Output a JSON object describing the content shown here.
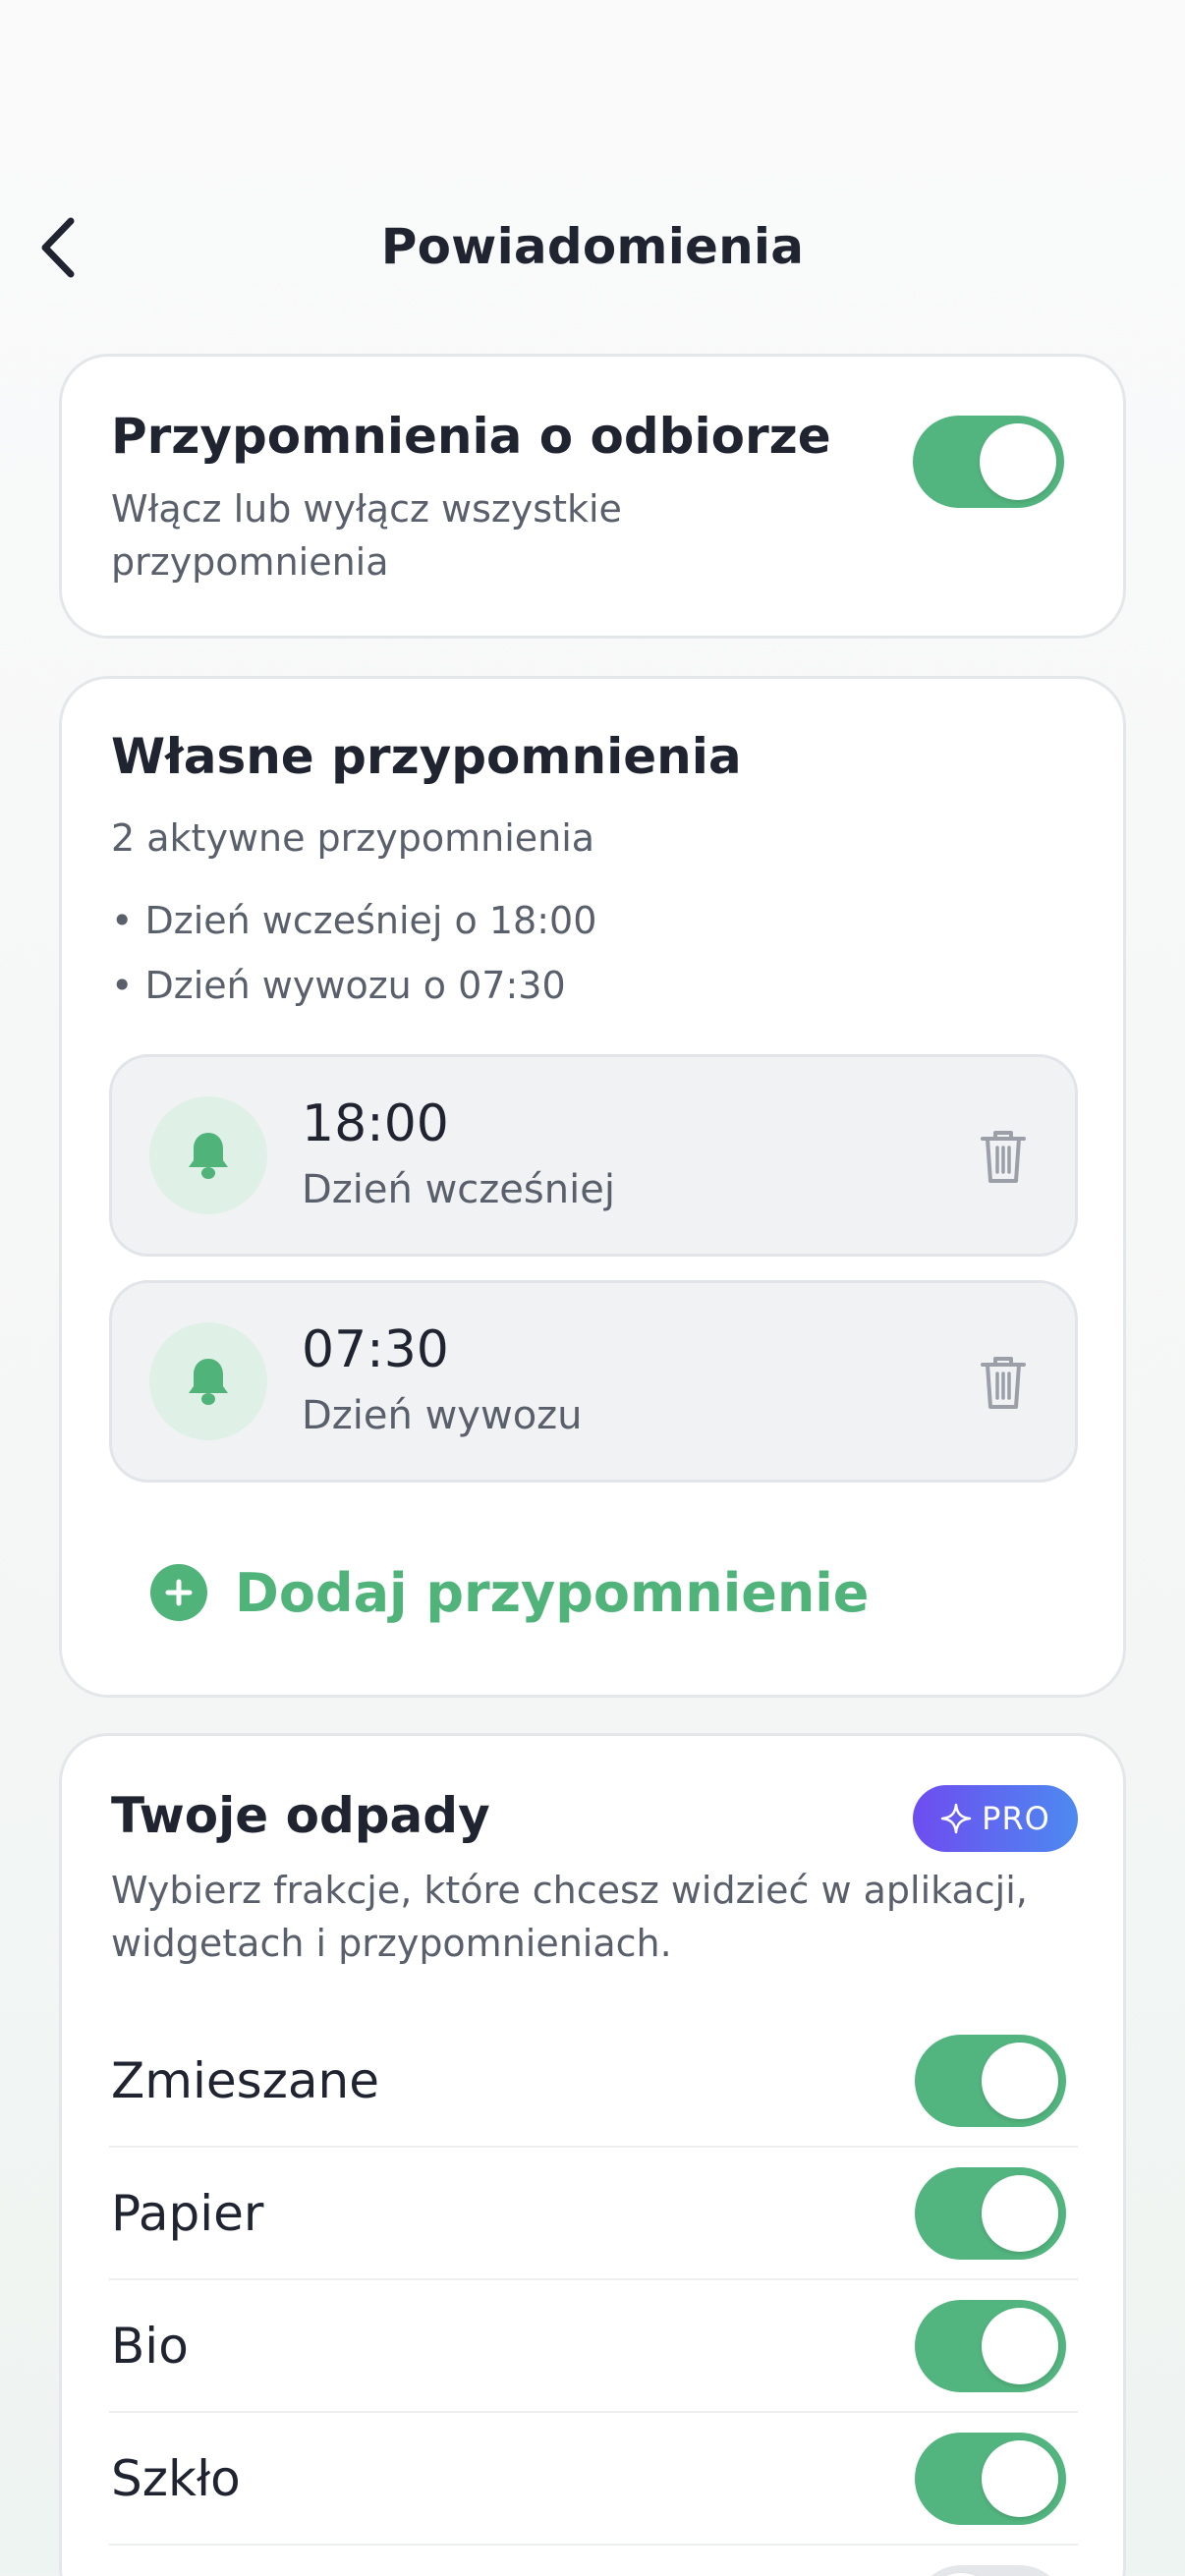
{
  "header": {
    "title": "Powiadomienia",
    "back_icon": "chevron-left-icon"
  },
  "master": {
    "title": "Przypomnienia o odbiorze",
    "subtitle_line1": "Włącz lub wyłącz wszystkie",
    "subtitle_line2": "przypomnienia",
    "enabled": true
  },
  "custom": {
    "title": "Własne przypomnienia",
    "count_text": "2 aktywne przypomnienia",
    "summary": [
      "• Dzień wcześniej o 18:00",
      "• Dzień wywozu o 07:30"
    ],
    "reminders": [
      {
        "time": "18:00",
        "label": "Dzień wcześniej",
        "icon": "bell-icon"
      },
      {
        "time": "07:30",
        "label": "Dzień wywozu",
        "icon": "bell-icon"
      }
    ],
    "add_label": "Dodaj przypomnienie"
  },
  "waste": {
    "title": "Twoje odpady",
    "badge": "PRO",
    "subtitle_line1": "Wybierz frakcje, które chcesz widzieć w aplikacji,",
    "subtitle_line2": "widgetach i przypomnieniach.",
    "items": [
      {
        "label": "Zmieszane",
        "enabled": true
      },
      {
        "label": "Papier",
        "enabled": true
      },
      {
        "label": "Bio",
        "enabled": true
      },
      {
        "label": "Szkło",
        "enabled": true
      },
      {
        "label": "",
        "enabled": false
      }
    ]
  },
  "colors": {
    "accent": "#52b47e",
    "text": "#1f2430",
    "muted": "#5a606b",
    "pro_gradient_start": "#6e4cf0",
    "pro_gradient_end": "#4d8af0"
  }
}
